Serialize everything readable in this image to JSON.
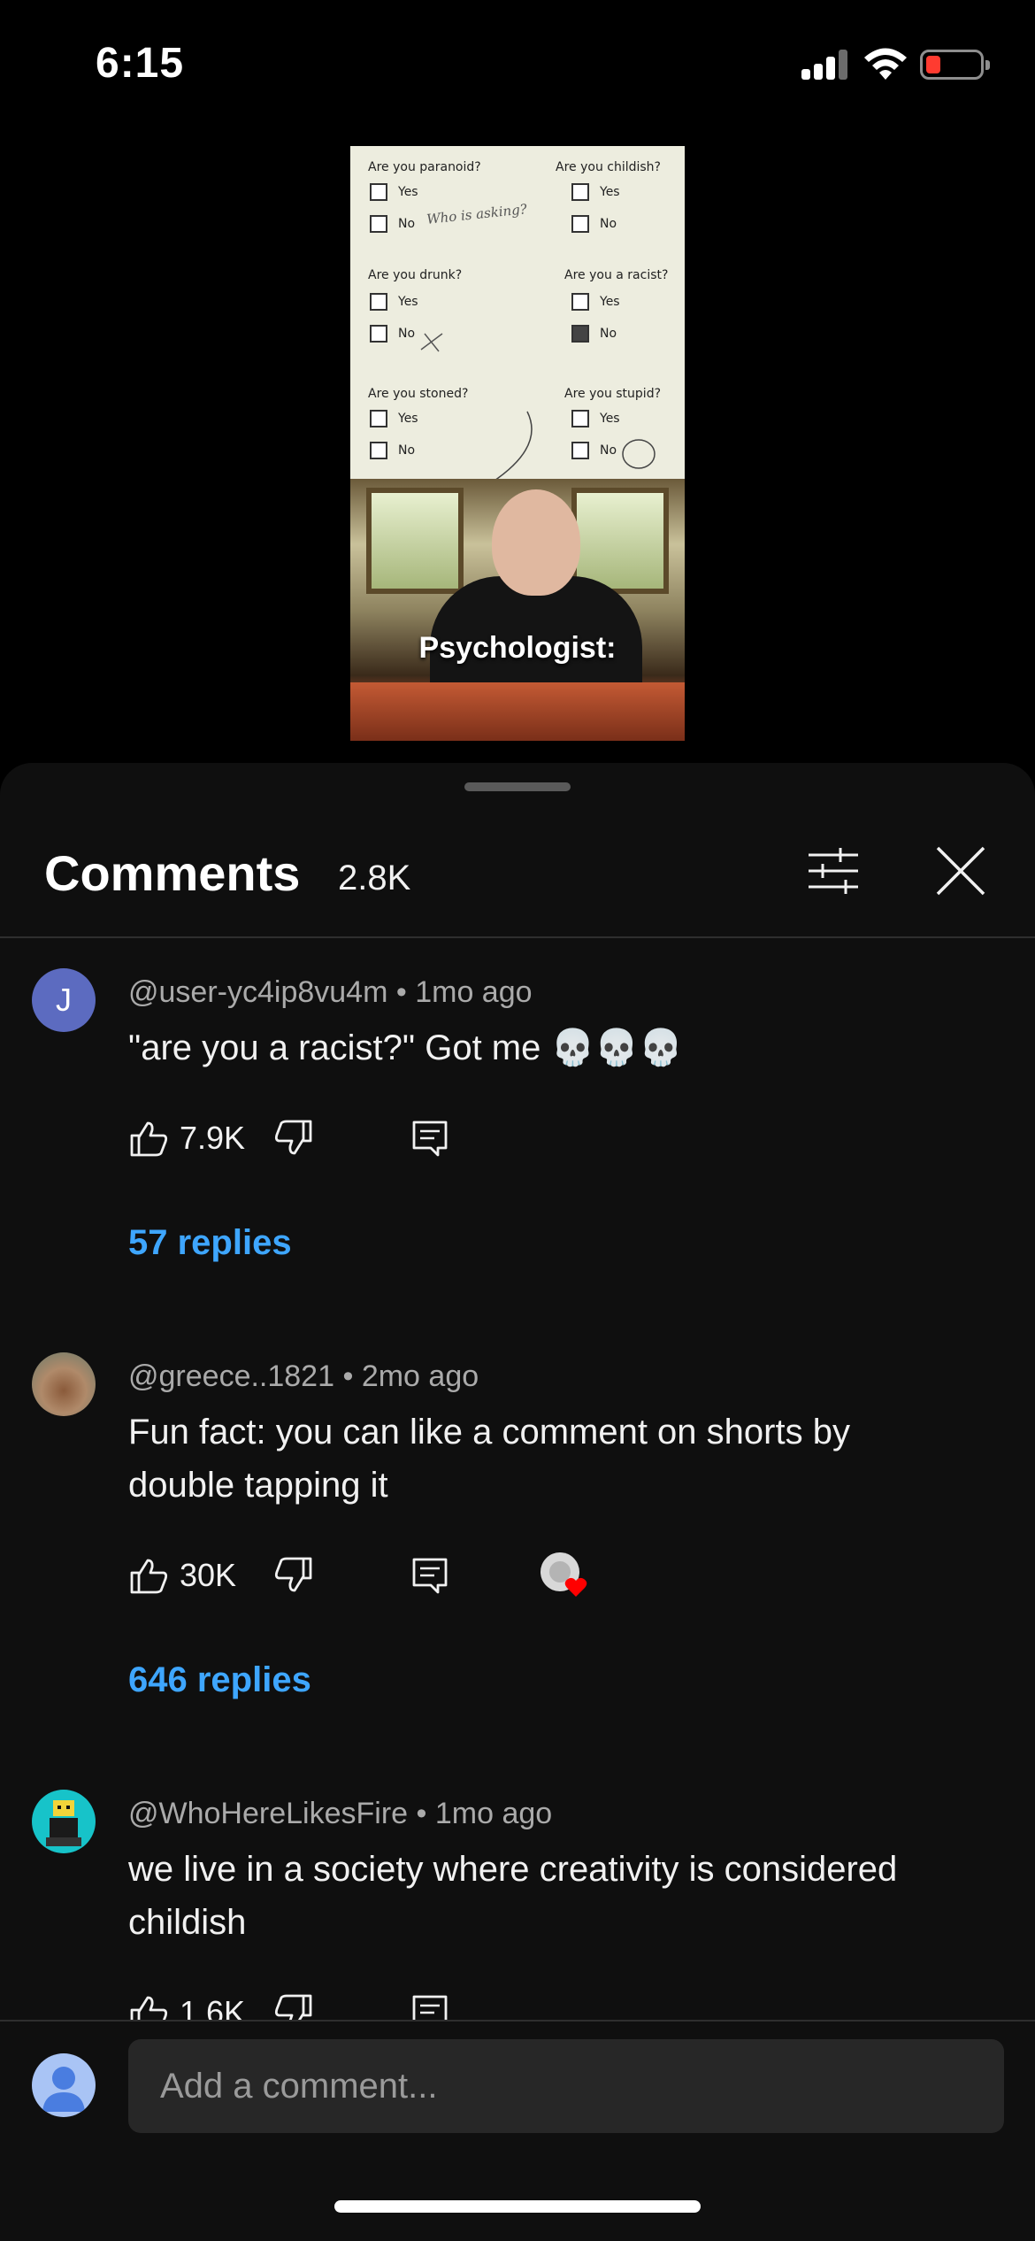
{
  "status_bar": {
    "time": "6:15",
    "battery_color": "#ff3b30"
  },
  "video": {
    "quiz": {
      "questions": [
        {
          "q": "Are you paranoid?",
          "yes": "Yes",
          "no": "No"
        },
        {
          "q": "Are you childish?",
          "yes": "Yes",
          "no": "No"
        },
        {
          "q": "Are you drunk?",
          "yes": "Yes",
          "no": "No"
        },
        {
          "q": "Are you a racist?",
          "yes": "Yes",
          "no": "No"
        },
        {
          "q": "Are you stoned?",
          "yes": "Yes",
          "no": "No"
        },
        {
          "q": "Are you stupid?",
          "yes": "Yes",
          "no": "No"
        }
      ],
      "handwritten_note": "Who is asking?"
    },
    "caption": "Psychologist:"
  },
  "comments_panel": {
    "title": "Comments",
    "count": "2.8K",
    "filter_icon": "sliders-icon",
    "close_icon": "close-icon"
  },
  "comments": [
    {
      "author": "@user-yc4ip8vu4m",
      "age": "1mo ago",
      "text": "\"are you a racist?\" Got me 💀💀💀",
      "likes": "7.9K",
      "replies": "57 replies",
      "avatar_letter": "J",
      "avatar_color": "#5c6bc0"
    },
    {
      "author": "@greece..1821",
      "age": "2mo ago",
      "text": "Fun fact: you can like a comment on shorts by double tapping it",
      "likes": "30K",
      "replies": "646 replies",
      "creator_heart": true
    },
    {
      "author": "@WhoHereLikesFire",
      "age": "1mo ago",
      "text": "we live in a society where creativity is considered childish",
      "likes": "1.6K"
    }
  ],
  "composer": {
    "placeholder": "Add a comment..."
  },
  "colors": {
    "link": "#3ea6ff",
    "sheet_bg": "#0f0f0f"
  }
}
